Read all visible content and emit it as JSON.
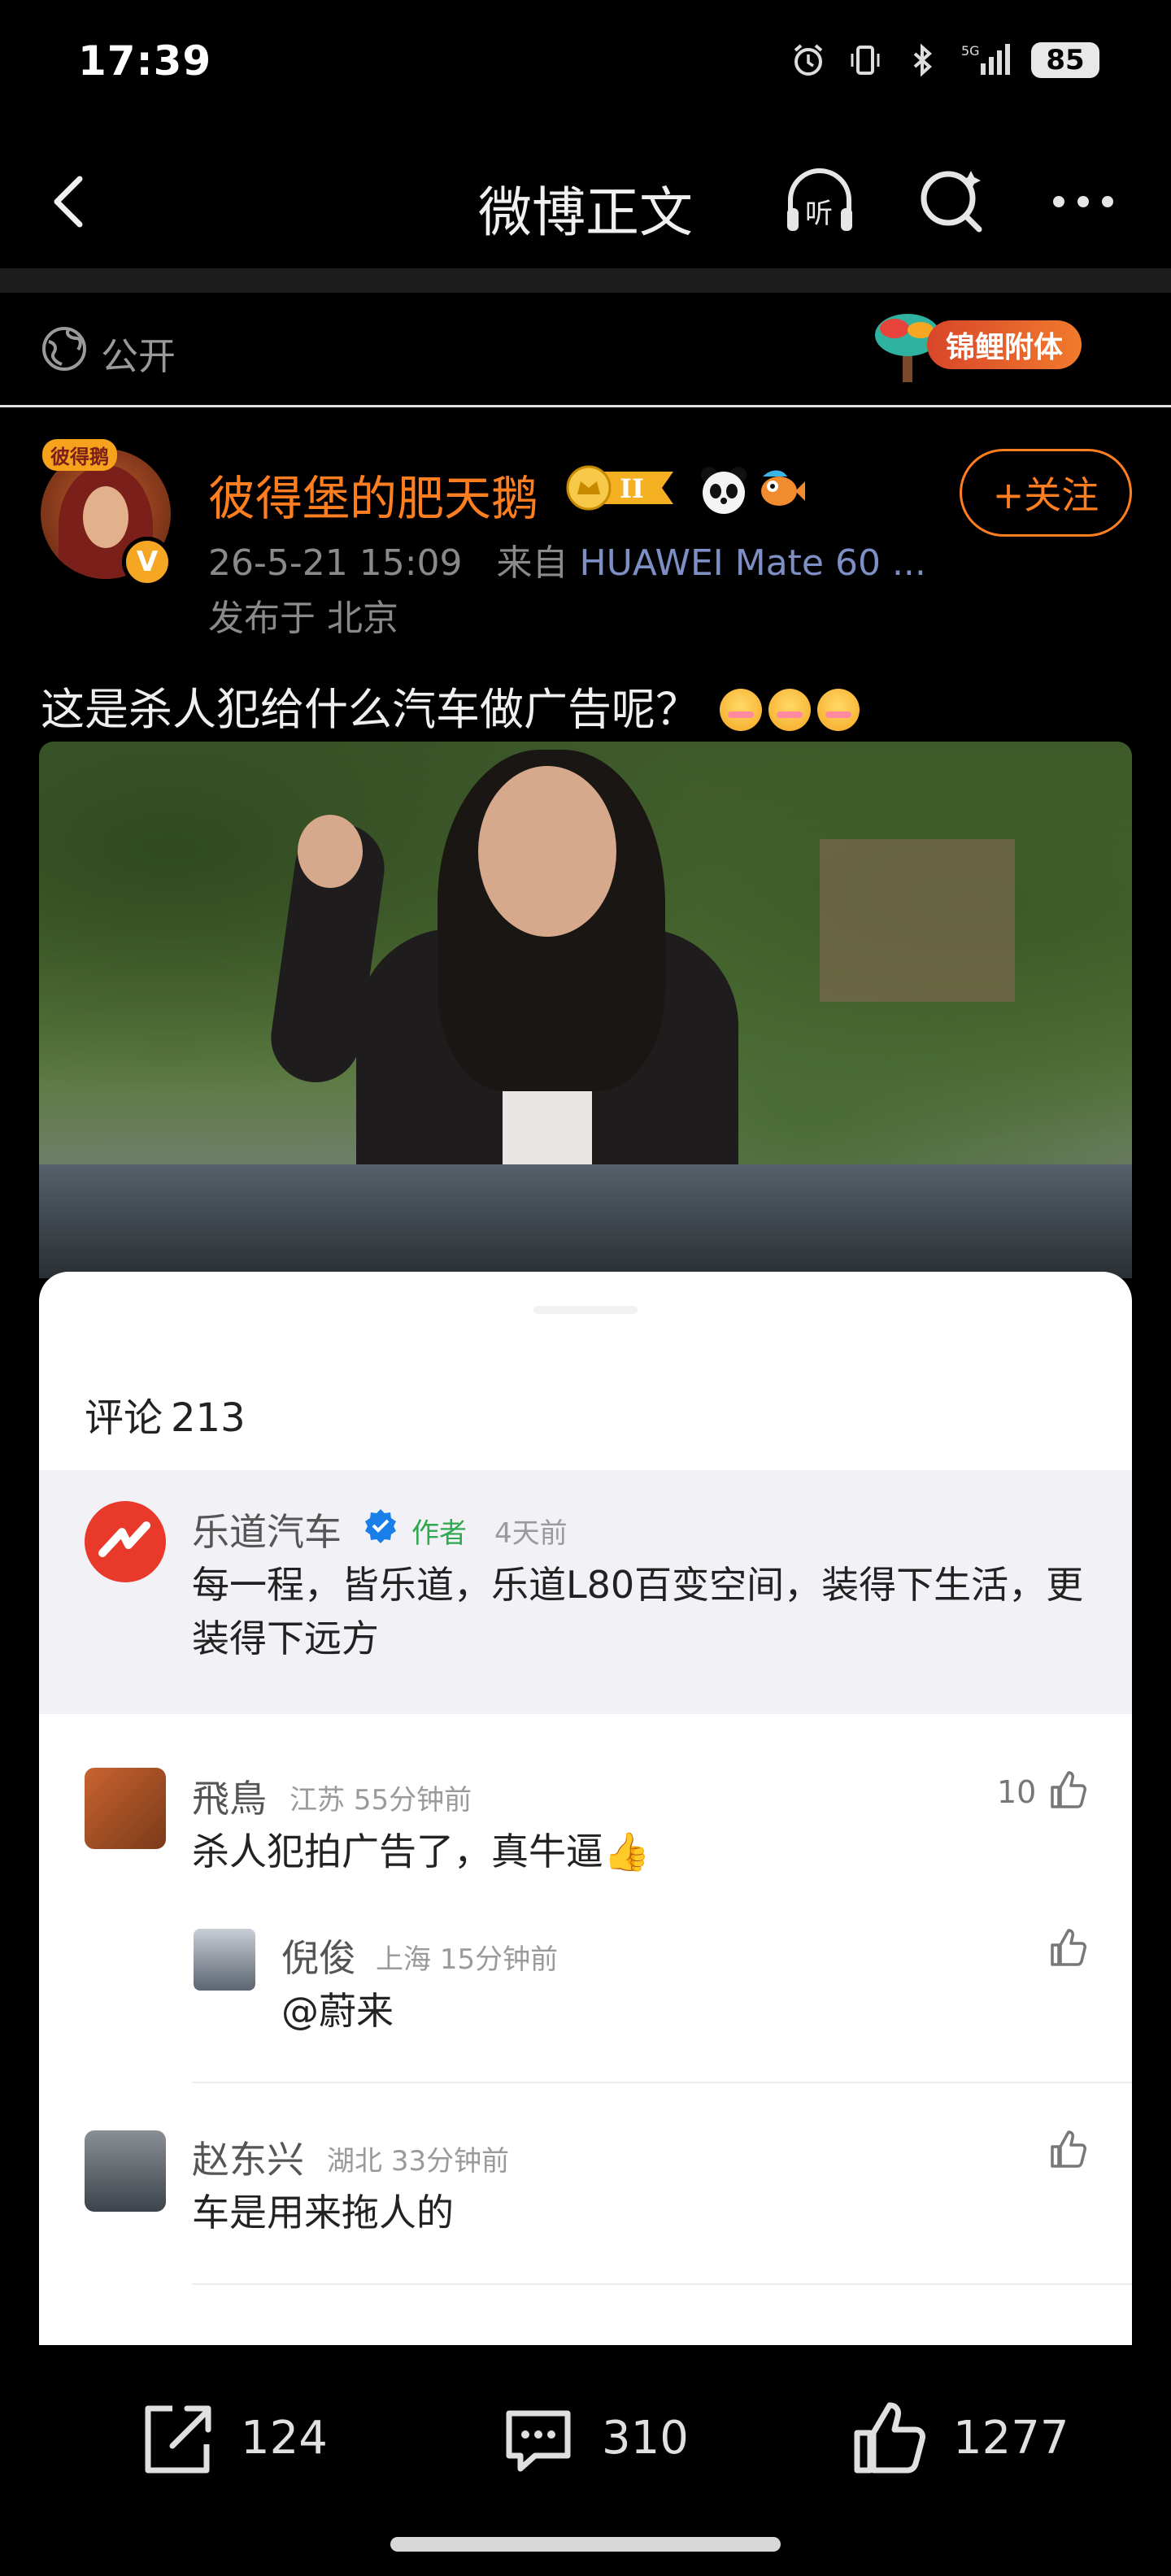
{
  "status_bar": {
    "time": "17:39",
    "network": "5G",
    "battery": "85"
  },
  "nav": {
    "title": "微博正文"
  },
  "visibility": {
    "label": "公开",
    "badge_label": "锦鲤附体"
  },
  "post": {
    "avatar_tag": "彼得鹅",
    "verified_mark": "V",
    "username": "彼得堡的肥天鹅",
    "vip_level": "II",
    "follow_label": "+关注",
    "timestamp": "26-5-21 15:09",
    "source_prefix": "来自",
    "device": "HUAWEI Mate 60 ...",
    "location": "发布于 北京",
    "text": "这是杀人犯给什么汽车做广告呢？"
  },
  "comments": {
    "title": "评论",
    "count": "213",
    "pinned": {
      "author": "乐道汽车",
      "tag": "作者",
      "time": "4天前",
      "text": "每一程，皆乐道，乐道L80百变空间，装得下生活，更装得下远方"
    },
    "items": [
      {
        "author": "飛鳥",
        "region": "江苏",
        "time": "55分钟前",
        "likes": "10",
        "text": "杀人犯拍广告了，真牛逼👍"
      },
      {
        "author": "倪俊",
        "region": "上海",
        "time": "15分钟前",
        "likes": "",
        "text": "@蔚来"
      },
      {
        "author": "赵东兴",
        "region": "湖北",
        "time": "33分钟前",
        "likes": "",
        "text": "车是用来拖人的"
      }
    ]
  },
  "actions": {
    "reposts": "124",
    "comments": "310",
    "likes": "1277"
  },
  "colors": {
    "accent": "#ff7e1f",
    "device_link": "#7d8fc4",
    "author_tag": "#2fa84f",
    "brand_red": "#e8392a"
  }
}
